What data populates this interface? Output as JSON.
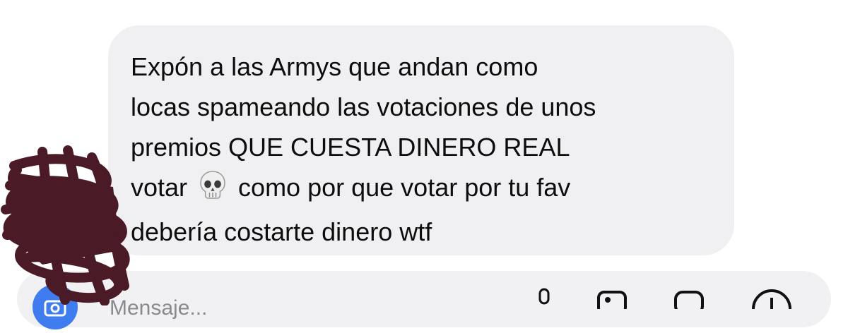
{
  "message": {
    "lines": [
      "Expón a las Armys que andan como",
      "locas spameando las votaciones de unos",
      "premios QUE CUESTA DINERO REAL",
      "votar",
      "como por que votar por tu fav",
      "debería costarte dinero wtf"
    ],
    "emoji": "skull-emoji"
  },
  "composer": {
    "placeholder": "Mensaje...",
    "icons": [
      "camera-icon",
      "microphone-icon",
      "gallery-icon",
      "sticker-icon",
      "plus-icon"
    ]
  },
  "colors": {
    "bubble": "#f0f0f2",
    "text": "#0d0d0d",
    "accent": "#3f7cf0",
    "scribble": "#4a1a26"
  }
}
